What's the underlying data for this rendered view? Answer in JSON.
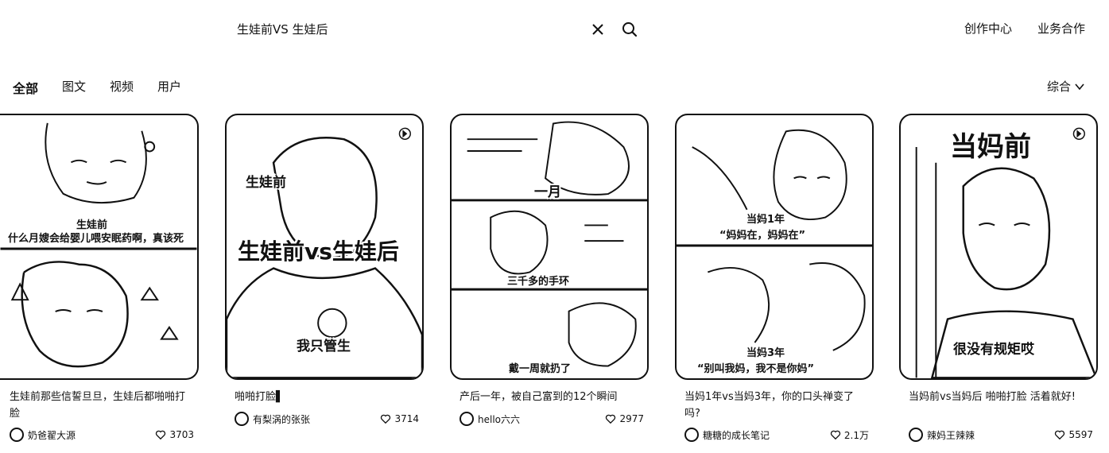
{
  "search": {
    "query": "生娃前VS 生娃后"
  },
  "header": {
    "links": [
      "创作中心",
      "业务合作"
    ]
  },
  "tabs": [
    "全部",
    "图文",
    "视频",
    "用户"
  ],
  "sort": {
    "label": "综合"
  },
  "cards": [
    {
      "captions": [
        "生娃前",
        "什么月嫂会给婴儿喂安眠药啊，真该死"
      ],
      "title": "生娃前那些信誓旦旦，生娃后都啪啪打脸",
      "author": "奶爸翟大源",
      "likes": "3703"
    },
    {
      "captions": [
        "生娃前",
        "生娃前vs生娃后",
        "我只管生"
      ],
      "title": "啪啪打脸▌",
      "author": "有梨涡的张张",
      "likes": "3714"
    },
    {
      "captions": [
        "一月",
        "三千多的手环",
        "戴一周就扔了"
      ],
      "title": "产后一年，被自己富到的12个瞬间",
      "author": "hello六六",
      "likes": "2977"
    },
    {
      "captions": [
        "当妈1年",
        "“妈妈在，妈妈在”",
        "当妈3年",
        "“别叫我妈，我不是你妈”"
      ],
      "title": "当妈1年vs当妈3年，你的口头禅变了吗?",
      "author": "糖糖的成长笔记",
      "likes": "2.1万"
    },
    {
      "captions": [
        "当妈前",
        "很没有规矩哎"
      ],
      "title": "当妈前vs当妈后 啪啪打脸 活着就好!",
      "author": "辣妈王辣辣",
      "likes": "5597"
    }
  ]
}
